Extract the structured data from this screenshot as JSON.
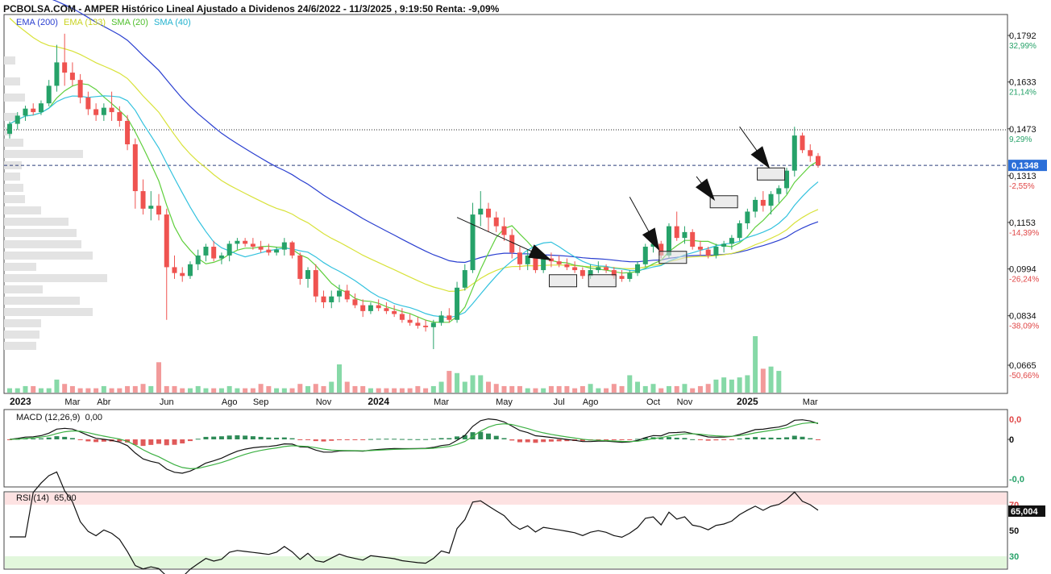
{
  "header": {
    "title": "PCBOLSA.COM - AMPER Histórico Lineal Ajustado a Dividenos 24/6/2022 - 11/3/2025 , 9:19:50 Renta: -9,09%"
  },
  "legend": [
    {
      "label": "EMA (200)",
      "color": "#2a3fd0"
    },
    {
      "label": "EMA (133)",
      "color": "#d8e23a"
    },
    {
      "label": "SMA (20)",
      "color": "#5fcf3c"
    },
    {
      "label": "SMA (40)",
      "color": "#33c2de"
    }
  ],
  "colors": {
    "up": "#26a269",
    "down": "#ef5350",
    "up_vol": "#86d9a7",
    "down_vol": "#f29a9a",
    "price_tag": "#2a6ed8"
  },
  "macd": {
    "label": "MACD (12,26,9)",
    "value": "0,00",
    "ticks": [
      "0,0",
      "0",
      "-0,0"
    ]
  },
  "rsi": {
    "label": "RSI (14)",
    "value": "65,00",
    "tag": "65,004",
    "ticks": [
      "70",
      "50",
      "30"
    ]
  },
  "chart_data": {
    "type": "candlestick",
    "price_axis": [
      {
        "price": "0,1792",
        "pct": "32,99%"
      },
      {
        "price": "0,1633",
        "pct": "21,14%"
      },
      {
        "price": "0,1473",
        "pct": "9,29%"
      },
      {
        "price": "0,1313",
        "pct": "-2,55%"
      },
      {
        "price": "0,1153",
        "pct": "-14,39%"
      },
      {
        "price": "0,0994",
        "pct": "-26,24%"
      },
      {
        "price": "0,0834",
        "pct": "-38,09%"
      },
      {
        "price": "0,0665",
        "pct": "-50,66%"
      }
    ],
    "current_price": "0,1348",
    "x_labels": [
      {
        "label": "2023",
        "bold": true,
        "t": 0
      },
      {
        "label": "Mar",
        "bold": false,
        "t": 8
      },
      {
        "label": "Abr",
        "bold": false,
        "t": 12
      },
      {
        "label": "Jun",
        "bold": false,
        "t": 20
      },
      {
        "label": "Ago",
        "bold": false,
        "t": 28
      },
      {
        "label": "Sep",
        "bold": false,
        "t": 32
      },
      {
        "label": "Nov",
        "bold": false,
        "t": 40
      },
      {
        "label": "2024",
        "bold": true,
        "t": 47
      },
      {
        "label": "Mar",
        "bold": false,
        "t": 55
      },
      {
        "label": "May",
        "bold": false,
        "t": 63
      },
      {
        "label": "Jul",
        "bold": false,
        "t": 70
      },
      {
        "label": "Ago",
        "bold": false,
        "t": 74
      },
      {
        "label": "Oct",
        "bold": false,
        "t": 82
      },
      {
        "label": "Nov",
        "bold": false,
        "t": 86
      },
      {
        "label": "2025",
        "bold": true,
        "t": 94
      },
      {
        "label": "Mar",
        "bold": false,
        "t": 102
      }
    ],
    "ohlc": [
      [
        0.1456,
        0.1498,
        0.144,
        0.149
      ],
      [
        0.149,
        0.153,
        0.147,
        0.1518
      ],
      [
        0.1518,
        0.1552,
        0.15,
        0.1542
      ],
      [
        0.1542,
        0.156,
        0.152,
        0.153
      ],
      [
        0.153,
        0.157,
        0.152,
        0.156
      ],
      [
        0.156,
        0.164,
        0.155,
        0.162
      ],
      [
        0.162,
        0.176,
        0.16,
        0.17
      ],
      [
        0.17,
        0.1798,
        0.162,
        0.1665
      ],
      [
        0.1665,
        0.17,
        0.162,
        0.164
      ],
      [
        0.164,
        0.166,
        0.156,
        0.158
      ],
      [
        0.158,
        0.16,
        0.152,
        0.154
      ],
      [
        0.154,
        0.156,
        0.15,
        0.152
      ],
      [
        0.152,
        0.156,
        0.15,
        0.1545
      ],
      [
        0.1545,
        0.16,
        0.15,
        0.153
      ],
      [
        0.153,
        0.155,
        0.148,
        0.15
      ],
      [
        0.15,
        0.152,
        0.14,
        0.142
      ],
      [
        0.142,
        0.144,
        0.12,
        0.126
      ],
      [
        0.126,
        0.13,
        0.118,
        0.12
      ],
      [
        0.12,
        0.126,
        0.116,
        0.121
      ],
      [
        0.121,
        0.125,
        0.116,
        0.118
      ],
      [
        0.118,
        0.12,
        0.082,
        0.1
      ],
      [
        0.1,
        0.104,
        0.096,
        0.098
      ],
      [
        0.098,
        0.1,
        0.095,
        0.097
      ],
      [
        0.097,
        0.102,
        0.096,
        0.101
      ],
      [
        0.101,
        0.106,
        0.099,
        0.104
      ],
      [
        0.104,
        0.108,
        0.102,
        0.107
      ],
      [
        0.107,
        0.109,
        0.102,
        0.103
      ],
      [
        0.103,
        0.105,
        0.101,
        0.104
      ],
      [
        0.104,
        0.109,
        0.102,
        0.108
      ],
      [
        0.108,
        0.11,
        0.106,
        0.109
      ],
      [
        0.109,
        0.11,
        0.107,
        0.108
      ],
      [
        0.108,
        0.11,
        0.106,
        0.107
      ],
      [
        0.107,
        0.109,
        0.105,
        0.106
      ],
      [
        0.106,
        0.108,
        0.104,
        0.105
      ],
      [
        0.105,
        0.107,
        0.104,
        0.106
      ],
      [
        0.106,
        0.11,
        0.104,
        0.1085
      ],
      [
        0.1085,
        0.109,
        0.103,
        0.104
      ],
      [
        0.104,
        0.105,
        0.094,
        0.096
      ],
      [
        0.096,
        0.1,
        0.093,
        0.099
      ],
      [
        0.099,
        0.101,
        0.088,
        0.09
      ],
      [
        0.09,
        0.092,
        0.086,
        0.088
      ],
      [
        0.088,
        0.092,
        0.086,
        0.09
      ],
      [
        0.09,
        0.094,
        0.088,
        0.092
      ],
      [
        0.092,
        0.094,
        0.088,
        0.089
      ],
      [
        0.089,
        0.091,
        0.086,
        0.087
      ],
      [
        0.087,
        0.089,
        0.083,
        0.085
      ],
      [
        0.085,
        0.088,
        0.084,
        0.087
      ],
      [
        0.087,
        0.089,
        0.085,
        0.086
      ],
      [
        0.086,
        0.088,
        0.084,
        0.085
      ],
      [
        0.085,
        0.087,
        0.083,
        0.084
      ],
      [
        0.084,
        0.086,
        0.081,
        0.082
      ],
      [
        0.082,
        0.084,
        0.08,
        0.081
      ],
      [
        0.081,
        0.083,
        0.079,
        0.08
      ],
      [
        0.08,
        0.082,
        0.078,
        0.0795
      ],
      [
        0.0795,
        0.082,
        0.072,
        0.081
      ],
      [
        0.081,
        0.085,
        0.08,
        0.0835
      ],
      [
        0.0835,
        0.086,
        0.081,
        0.082
      ],
      [
        0.082,
        0.095,
        0.081,
        0.093
      ],
      [
        0.093,
        0.101,
        0.092,
        0.099
      ],
      [
        0.099,
        0.122,
        0.098,
        0.118
      ],
      [
        0.118,
        0.126,
        0.114,
        0.12
      ],
      [
        0.12,
        0.122,
        0.112,
        0.117
      ],
      [
        0.117,
        0.119,
        0.112,
        0.114
      ],
      [
        0.114,
        0.117,
        0.109,
        0.111
      ],
      [
        0.111,
        0.113,
        0.103,
        0.105
      ],
      [
        0.105,
        0.107,
        0.099,
        0.101
      ],
      [
        0.101,
        0.106,
        0.099,
        0.104
      ],
      [
        0.104,
        0.105,
        0.098,
        0.099
      ],
      [
        0.099,
        0.104,
        0.098,
        0.103
      ],
      [
        0.103,
        0.105,
        0.1,
        0.102
      ],
      [
        0.102,
        0.104,
        0.1,
        0.101
      ],
      [
        0.101,
        0.103,
        0.099,
        0.1
      ],
      [
        0.1,
        0.102,
        0.098,
        0.099
      ],
      [
        0.099,
        0.1,
        0.096,
        0.097
      ],
      [
        0.097,
        0.101,
        0.096,
        0.099
      ],
      [
        0.099,
        0.102,
        0.098,
        0.1
      ],
      [
        0.1,
        0.101,
        0.098,
        0.099
      ],
      [
        0.099,
        0.1,
        0.096,
        0.097
      ],
      [
        0.097,
        0.099,
        0.095,
        0.096
      ],
      [
        0.096,
        0.099,
        0.095,
        0.098
      ],
      [
        0.098,
        0.102,
        0.097,
        0.101
      ],
      [
        0.101,
        0.108,
        0.1,
        0.107
      ],
      [
        0.107,
        0.11,
        0.105,
        0.108
      ],
      [
        0.108,
        0.109,
        0.103,
        0.104
      ],
      [
        0.104,
        0.115,
        0.103,
        0.114
      ],
      [
        0.114,
        0.119,
        0.109,
        0.11
      ],
      [
        0.11,
        0.114,
        0.108,
        0.112
      ],
      [
        0.112,
        0.113,
        0.106,
        0.107
      ],
      [
        0.107,
        0.109,
        0.104,
        0.106
      ],
      [
        0.106,
        0.107,
        0.103,
        0.104
      ],
      [
        0.104,
        0.108,
        0.103,
        0.107
      ],
      [
        0.107,
        0.109,
        0.105,
        0.108
      ],
      [
        0.108,
        0.111,
        0.106,
        0.11
      ],
      [
        0.11,
        0.116,
        0.109,
        0.115
      ],
      [
        0.115,
        0.12,
        0.113,
        0.119
      ],
      [
        0.119,
        0.124,
        0.117,
        0.123
      ],
      [
        0.123,
        0.126,
        0.119,
        0.121
      ],
      [
        0.121,
        0.126,
        0.118,
        0.125
      ],
      [
        0.125,
        0.128,
        0.122,
        0.127
      ],
      [
        0.127,
        0.134,
        0.125,
        0.133
      ],
      [
        0.133,
        0.148,
        0.131,
        0.145
      ],
      [
        0.145,
        0.146,
        0.139,
        0.14
      ],
      [
        0.14,
        0.142,
        0.136,
        0.138
      ],
      [
        0.138,
        0.139,
        0.134,
        0.1348
      ]
    ],
    "volumes": [
      2,
      2,
      3,
      3,
      2,
      2,
      6,
      4,
      3,
      2,
      2,
      2,
      3,
      2,
      2,
      3,
      3,
      4,
      3,
      14,
      3,
      3,
      2,
      2,
      3,
      2,
      2,
      2,
      3,
      2,
      2,
      2,
      4,
      3,
      2,
      2,
      2,
      4,
      3,
      4,
      3,
      5,
      13,
      5,
      3,
      3,
      2,
      2,
      2,
      2,
      2,
      2,
      3,
      2,
      3,
      5,
      10,
      9,
      5,
      8,
      8,
      5,
      4,
      3,
      3,
      3,
      2,
      2,
      2,
      3,
      3,
      3,
      2,
      3,
      4,
      2,
      2,
      4,
      3,
      8,
      5,
      3,
      4,
      2,
      3,
      3,
      4,
      2,
      3,
      4,
      6,
      7,
      6,
      7,
      8,
      26,
      11,
      12,
      10
    ],
    "emphasis_boxes": [
      {
        "t": 70.5,
        "price": 0.0955
      },
      {
        "t": 75.5,
        "price": 0.0955
      },
      {
        "t": 84.5,
        "price": 0.1035
      },
      {
        "t": 91,
        "price": 0.1225
      },
      {
        "t": 97,
        "price": 0.132
      }
    ],
    "annotation_arrows": [
      {
        "from_t": 57,
        "from_p": 0.117,
        "to_t": 68.5,
        "to_p": 0.103
      },
      {
        "from_t": 79,
        "from_p": 0.124,
        "to_t": 82.5,
        "to_p": 0.107
      },
      {
        "from_t": 87.5,
        "from_p": 0.131,
        "to_t": 89.5,
        "to_p": 0.124
      },
      {
        "from_t": 93,
        "from_p": 0.148,
        "to_t": 96.5,
        "to_p": 0.135
      }
    ]
  }
}
